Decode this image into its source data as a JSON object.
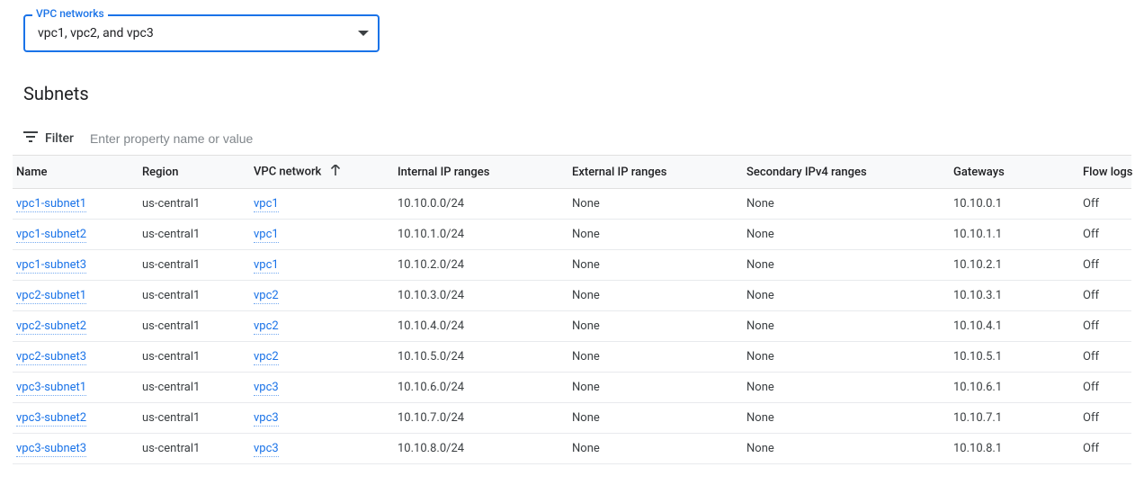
{
  "dropdown": {
    "legend": "VPC networks",
    "selected": "vpc1, vpc2, and vpc3"
  },
  "section_title": "Subnets",
  "filter": {
    "label": "Filter",
    "placeholder": "Enter property name or value"
  },
  "table": {
    "columns": {
      "name": "Name",
      "region": "Region",
      "vpc": "VPC network",
      "int_ip": "Internal IP ranges",
      "ext_ip": "External IP ranges",
      "sec_ip": "Secondary IPv4 ranges",
      "gw": "Gateways",
      "flow": "Flow logs"
    },
    "sort": {
      "column": "vpc",
      "dir": "asc"
    },
    "rows": [
      {
        "name": "vpc1-subnet1",
        "region": "us-central1",
        "vpc": "vpc1",
        "int_ip": "10.10.0.0/24",
        "ext_ip": "None",
        "sec_ip": "None",
        "gw": "10.10.0.1",
        "flow": "Off"
      },
      {
        "name": "vpc1-subnet2",
        "region": "us-central1",
        "vpc": "vpc1",
        "int_ip": "10.10.1.0/24",
        "ext_ip": "None",
        "sec_ip": "None",
        "gw": "10.10.1.1",
        "flow": "Off"
      },
      {
        "name": "vpc1-subnet3",
        "region": "us-central1",
        "vpc": "vpc1",
        "int_ip": "10.10.2.0/24",
        "ext_ip": "None",
        "sec_ip": "None",
        "gw": "10.10.2.1",
        "flow": "Off"
      },
      {
        "name": "vpc2-subnet1",
        "region": "us-central1",
        "vpc": "vpc2",
        "int_ip": "10.10.3.0/24",
        "ext_ip": "None",
        "sec_ip": "None",
        "gw": "10.10.3.1",
        "flow": "Off"
      },
      {
        "name": "vpc2-subnet2",
        "region": "us-central1",
        "vpc": "vpc2",
        "int_ip": "10.10.4.0/24",
        "ext_ip": "None",
        "sec_ip": "None",
        "gw": "10.10.4.1",
        "flow": "Off"
      },
      {
        "name": "vpc2-subnet3",
        "region": "us-central1",
        "vpc": "vpc2",
        "int_ip": "10.10.5.0/24",
        "ext_ip": "None",
        "sec_ip": "None",
        "gw": "10.10.5.1",
        "flow": "Off"
      },
      {
        "name": "vpc3-subnet1",
        "region": "us-central1",
        "vpc": "vpc3",
        "int_ip": "10.10.6.0/24",
        "ext_ip": "None",
        "sec_ip": "None",
        "gw": "10.10.6.1",
        "flow": "Off"
      },
      {
        "name": "vpc3-subnet2",
        "region": "us-central1",
        "vpc": "vpc3",
        "int_ip": "10.10.7.0/24",
        "ext_ip": "None",
        "sec_ip": "None",
        "gw": "10.10.7.1",
        "flow": "Off"
      },
      {
        "name": "vpc3-subnet3",
        "region": "us-central1",
        "vpc": "vpc3",
        "int_ip": "10.10.8.0/24",
        "ext_ip": "None",
        "sec_ip": "None",
        "gw": "10.10.8.1",
        "flow": "Off"
      }
    ]
  }
}
